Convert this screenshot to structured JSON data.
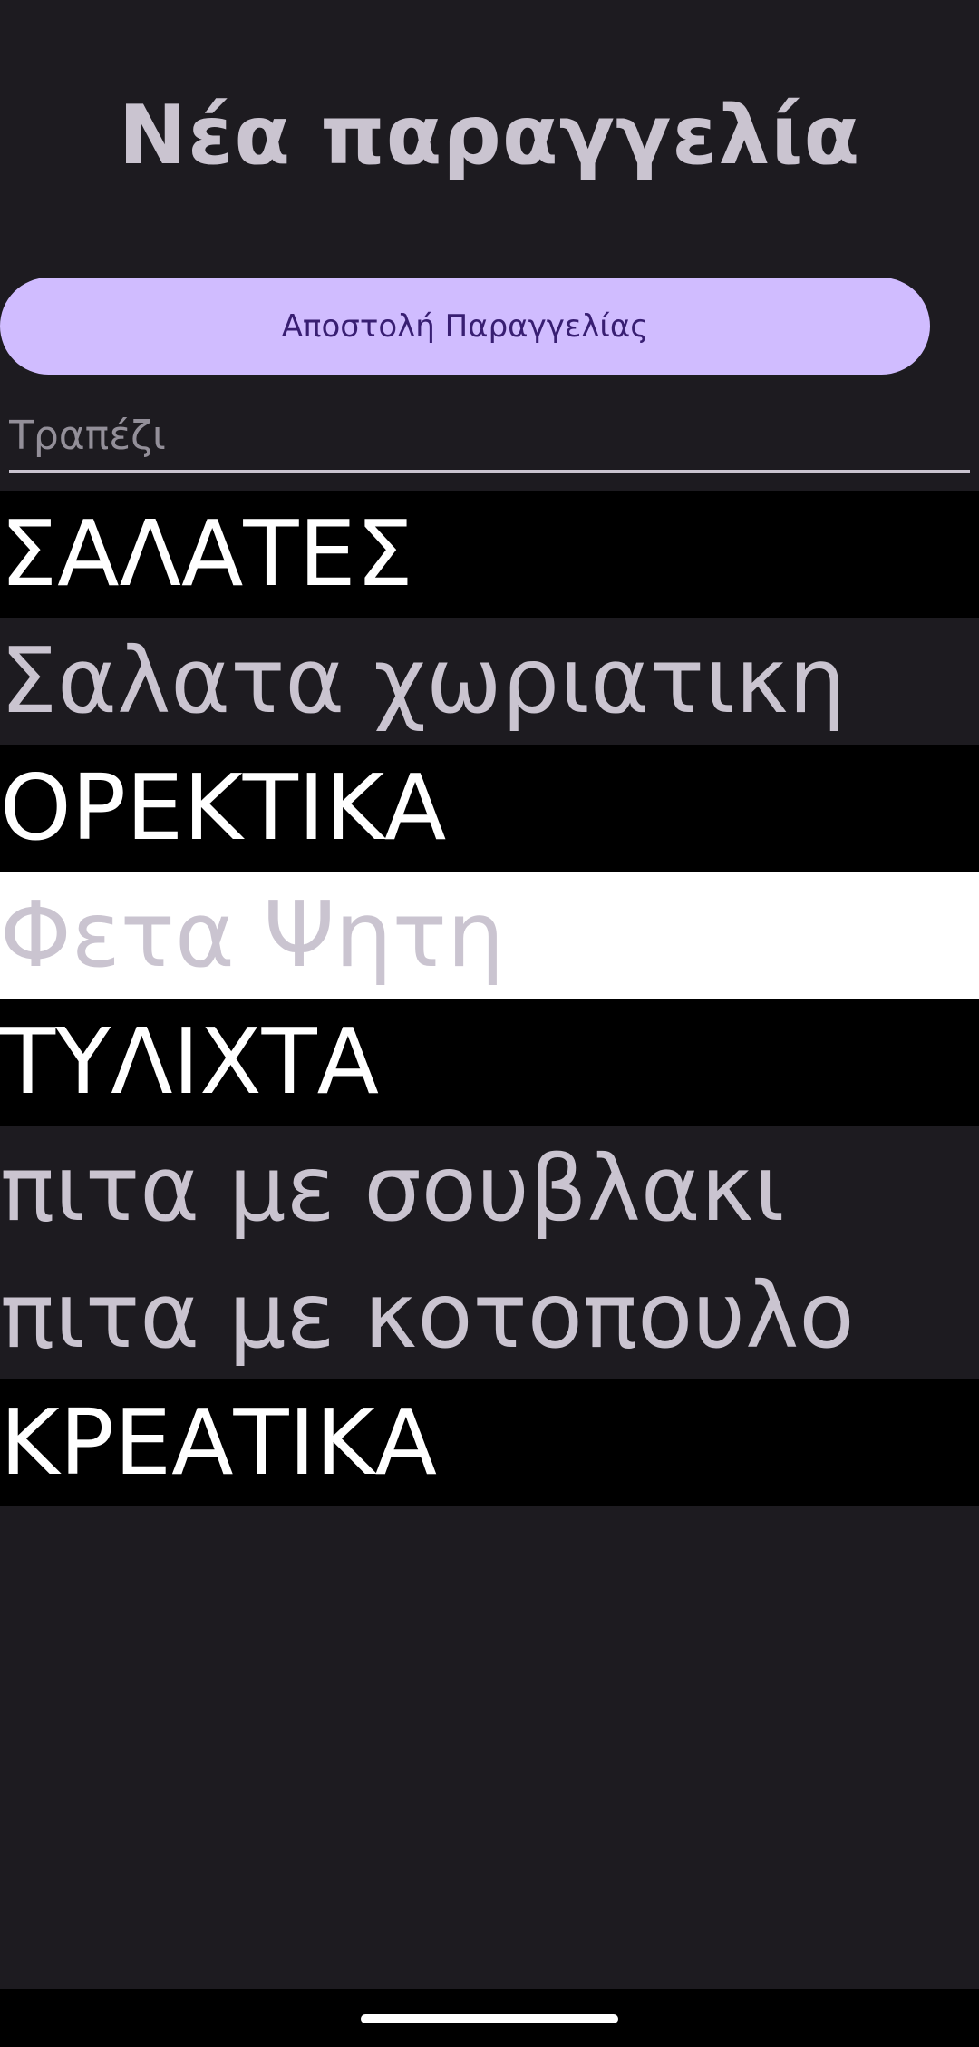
{
  "header": {
    "title": "Νέα παραγγελία"
  },
  "actions": {
    "send_label": "Αποστολή Παραγγελίας"
  },
  "table_field": {
    "placeholder": "Τραπέζι",
    "value": ""
  },
  "menu": {
    "rows": [
      {
        "type": "category",
        "label": "ΣΑΛΑΤΕΣ"
      },
      {
        "type": "item",
        "label": "Σαλατα χωριατικη"
      },
      {
        "type": "category",
        "label": "ΟΡΕΚΤΙΚΑ"
      },
      {
        "type": "item",
        "label": "Φετα Ψητη",
        "selected": true
      },
      {
        "type": "category",
        "label": "ΤΥΛΙΧΤΑ"
      },
      {
        "type": "item",
        "label": "πιτα με σουβλακι"
      },
      {
        "type": "item",
        "label": "πιτα με κοτοπουλο"
      },
      {
        "type": "category",
        "label": "ΚΡΕΑΤΙΚΑ"
      }
    ]
  },
  "colors": {
    "background": "#1d1b20",
    "accent": "#d0bcff",
    "on_accent": "#381e72",
    "category_bg": "#000000",
    "category_text": "#ffffff",
    "item_text": "#cac4d0",
    "selected_bg": "#ffffff"
  }
}
